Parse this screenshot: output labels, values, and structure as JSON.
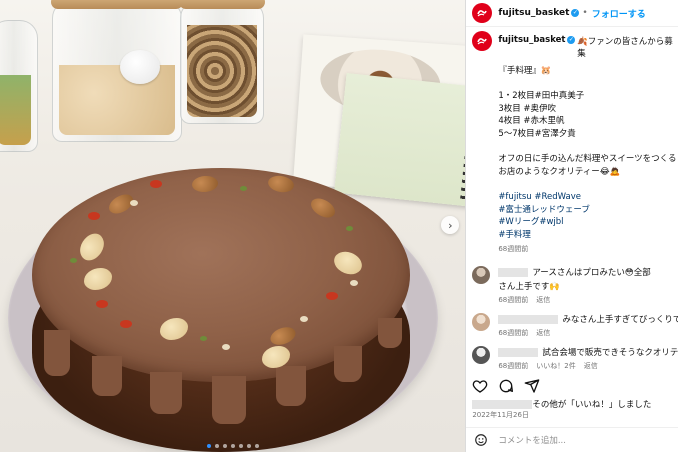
{
  "post": {
    "username": "fujitsu_basket",
    "follow_label": "フォローする",
    "verified_glyph": "✓",
    "caption_intro": "🍂ファンの皆さんから募集",
    "caption_lines": [
      "『手料理』🐹",
      "",
      "1・2枚目#田中真美子",
      "3枚目 #奥伊吹",
      "4枚目 #赤木里帆",
      "5〜7枚目#宮澤夕貴",
      "",
      "オフの日に手の込んだ料理やスイーツをつくる",
      "お店のようなクオリティー😂🙇",
      "",
      "#fujitsu #RedWave",
      "#富士通レッドウェーブ",
      "#Wリーグ#wjbl",
      "#手料理"
    ],
    "caption_time": "68週間前",
    "likes_text": "その他が「いいね！」しました",
    "date": "2022年11月26日",
    "add_comment_placeholder": "コメントを追加...",
    "next_glyph": "›"
  },
  "comments": [
    {
      "text": "アースさんはプロみたい😳全部",
      "text2": "さん上手です🙌",
      "time": "68週間前",
      "reply": "返信"
    },
    {
      "text": "みなさん上手すぎてびっくりです!",
      "time": "68週間前",
      "reply": "返信"
    },
    {
      "text": "試合会場で販売できそうなクオリテ",
      "time": "68週間前",
      "likes": "いいね！2件",
      "reply": "返信"
    }
  ],
  "colors": {
    "brand": "#e0001a",
    "link": "#0095f6",
    "hashtag": "#00376b",
    "meta": "#737373"
  },
  "icons": [
    "heart-icon",
    "comment-icon",
    "share-icon",
    "emoji-icon",
    "next-arrow-icon"
  ]
}
